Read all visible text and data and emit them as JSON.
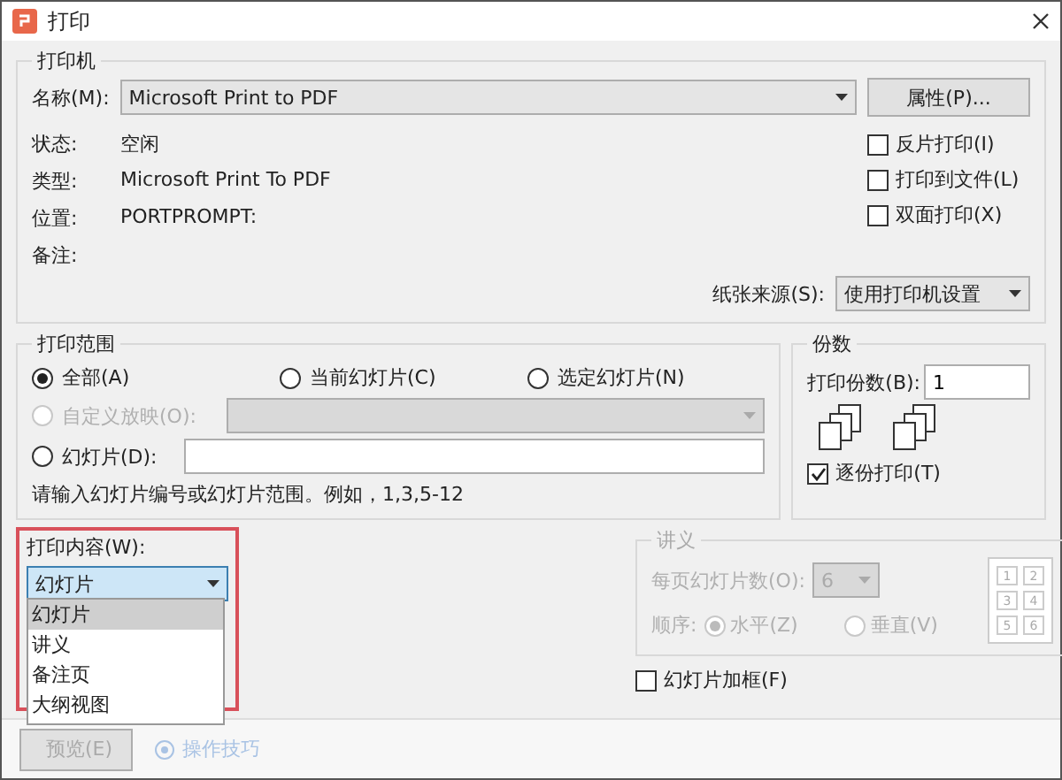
{
  "window": {
    "title": "打印"
  },
  "printer": {
    "legend": "打印机",
    "name_label": "名称(M):",
    "name_value": "Microsoft Print to PDF",
    "properties_button": "属性(P)...",
    "info": [
      {
        "label": "状态:",
        "value": "空闲"
      },
      {
        "label": "类型:",
        "value": "Microsoft Print To PDF"
      },
      {
        "label": "位置:",
        "value": "PORTPROMPT:"
      },
      {
        "label": "备注:"
      }
    ],
    "options": [
      {
        "label": "反片打印(I)",
        "checked": false
      },
      {
        "label": "打印到文件(L)",
        "checked": false
      },
      {
        "label": "双面打印(X)",
        "checked": false
      }
    ],
    "paper_source_label": "纸张来源(S):",
    "paper_source_value": "使用打印机设置"
  },
  "range": {
    "legend": "打印范围",
    "options": [
      {
        "label": "全部(A)",
        "selected": true
      },
      {
        "label": "当前幻灯片(C)",
        "selected": false
      },
      {
        "label": "选定幻灯片(N)",
        "selected": false
      }
    ],
    "custom": {
      "label": "自定义放映(O):",
      "selected": false,
      "disabled": true
    },
    "slides": {
      "label": "幻灯片(D):",
      "selected": false
    },
    "hint": "请输入幻灯片编号或幻灯片范围。例如，1,3,5-12"
  },
  "copies": {
    "legend": "份数",
    "label": "打印份数(B):",
    "value": "1",
    "collate": {
      "label": "逐份打印(T)",
      "checked": true
    }
  },
  "content": {
    "label": "打印内容(W):",
    "value": "幻灯片",
    "expanded": true,
    "options": [
      {
        "label": "幻灯片",
        "selected": true
      },
      {
        "label": "讲义",
        "selected": false
      },
      {
        "label": "备注页",
        "selected": false
      },
      {
        "label": "大纲视图",
        "selected": false
      }
    ]
  },
  "handouts": {
    "legend": "讲义",
    "disabled": true,
    "per_page_label": "每页幻灯片数(O):",
    "per_page_value": "6",
    "order_label": "顺序:",
    "order": [
      {
        "label": "水平(Z)",
        "selected": true
      },
      {
        "label": "垂直(V)",
        "selected": false
      }
    ],
    "preview": [
      "1",
      "2",
      "3",
      "4",
      "5",
      "6"
    ]
  },
  "frame": {
    "label": "幻灯片加框(F)",
    "checked": false
  },
  "footer": {
    "preview_button": "预览(E)",
    "tips_link": "操作技巧"
  }
}
